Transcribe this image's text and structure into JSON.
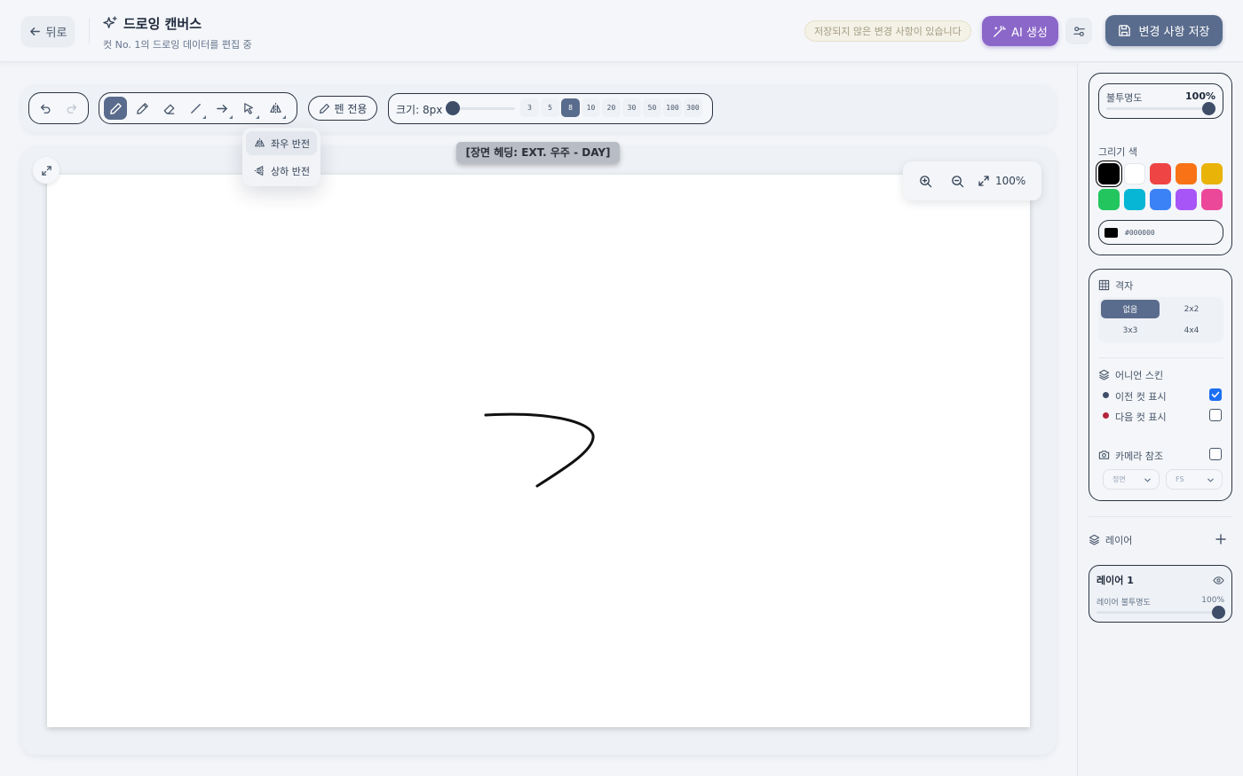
{
  "header": {
    "back_label": "뒤로",
    "title": "드로잉 캔버스",
    "subtitle": "컷 No. 1의 드로잉 데이터를 편집 중",
    "unsaved_notice": "저장되지 않은 변경 사항이 있습니다",
    "ai_label": "AI 생성",
    "save_label": "변경 사항 저장"
  },
  "toolbar": {
    "tools": [
      "undo-icon",
      "redo-icon",
      "pen-icon",
      "pencil-icon",
      "eraser-icon",
      "line-icon",
      "arrow-icon",
      "select-icon",
      "flip-icon"
    ],
    "active_tool": "pen",
    "pen_only_label": "펜 전용",
    "size_label": "크기: 8px",
    "size_presets": [
      "3",
      "5",
      "8",
      "10",
      "20",
      "30",
      "50",
      "100",
      "300"
    ],
    "active_size": "8"
  },
  "flip_menu": {
    "horizontal": "좌우 반전",
    "vertical": "상하 반전"
  },
  "canvas": {
    "scene_label": "[장면 헤딩: EXT. 우주 - DAY]",
    "zoom": "100%"
  },
  "sidebar": {
    "opacity_label": "불투명도",
    "opacity_value": "100%",
    "opacity_level": 1.0,
    "color_label": "그리기 색",
    "colors": [
      "#000000",
      "#ffffff",
      "#ef4444",
      "#f97316",
      "#eab308",
      "#22c55e",
      "#06b6d4",
      "#3b82f6",
      "#a855f7",
      "#ec4899"
    ],
    "selected_color": "#000000",
    "hex_value": "#000000",
    "grid_label": "격자",
    "grid_options": [
      "없음",
      "2x2",
      "3x3",
      "4x4"
    ],
    "grid_selected": "없음",
    "onion_label": "어니언 스킨",
    "onion_prev_label": "이전 컷 표시",
    "onion_prev_checked": true,
    "onion_next_label": "다음 컷 표시",
    "onion_next_checked": false,
    "camera_label": "카메라 참조",
    "camera_checked": false,
    "camera_angle": "정면",
    "camera_shot": "FS",
    "layers_label": "레이어",
    "layer_name": "레이어 1",
    "layer_opacity_label": "레이어 불투명도",
    "layer_opacity_value": "100%"
  },
  "colors": {
    "accent": "#5a6c8d",
    "ai": "#8b67c9",
    "checkbox": "#1d6ff2"
  }
}
